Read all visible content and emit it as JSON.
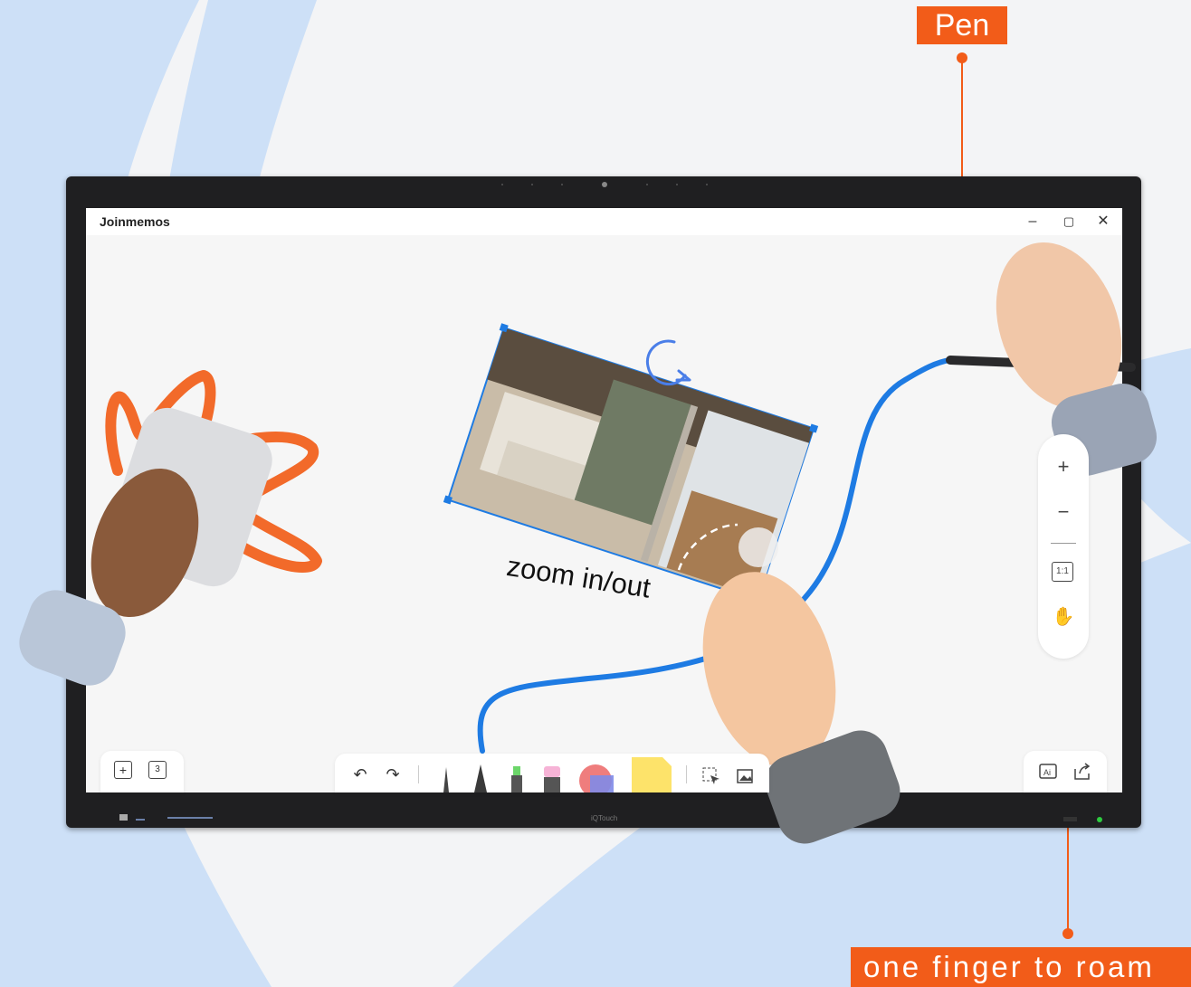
{
  "callouts": {
    "pen": "Pen",
    "roam": "one finger to roam"
  },
  "app": {
    "title": "Joinmemos",
    "window_controls": {
      "minimize": "–",
      "maximize": "▢",
      "close": "✕"
    }
  },
  "canvas": {
    "gesture_label": "zoom in/out"
  },
  "zoom_panel": {
    "zoom_in": "+",
    "zoom_out": "−",
    "fit": "1:1",
    "hand": "✋"
  },
  "left_panel": {
    "add_page": "+",
    "pages": "3"
  },
  "toolbar": {
    "undo": "↶",
    "redo": "↷"
  },
  "colors": {
    "accent_orange": "#f25c19",
    "stroke_blue": "#1e7be3",
    "doodle_orange": "#f26a2a",
    "bg_blue": "#cde0f7"
  },
  "icons": [
    "undo-icon",
    "redo-icon",
    "pen-thin-icon",
    "pen-thick-icon",
    "highlighter-icon",
    "eraser-icon",
    "shape-icon",
    "sticky-note-icon",
    "lasso-select-icon",
    "image-icon",
    "add-page-icon",
    "pages-icon",
    "ai-icon",
    "share-icon",
    "zoom-in-icon",
    "zoom-out-icon",
    "fit-icon",
    "hand-icon"
  ]
}
